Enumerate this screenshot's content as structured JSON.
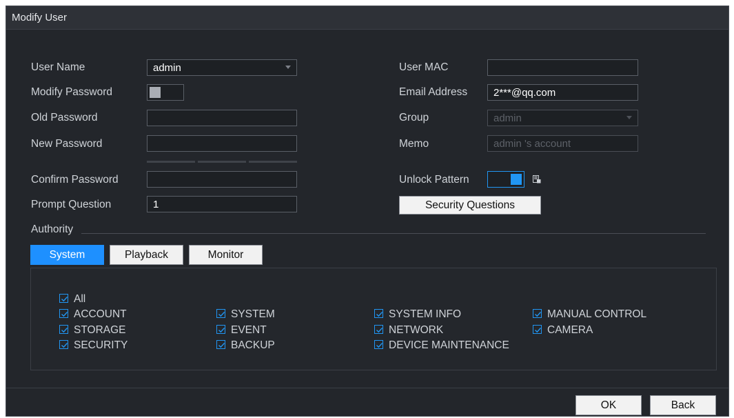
{
  "window": {
    "title": "Modify User"
  },
  "form": {
    "user_name": {
      "label": "User Name",
      "value": "admin"
    },
    "modify_password": {
      "label": "Modify Password",
      "enabled": false
    },
    "old_password": {
      "label": "Old Password",
      "value": ""
    },
    "new_password": {
      "label": "New Password",
      "value": ""
    },
    "confirm_password": {
      "label": "Confirm Password",
      "value": ""
    },
    "prompt_question": {
      "label": "Prompt Question",
      "value": "1"
    },
    "user_mac": {
      "label": "User MAC",
      "value": ""
    },
    "email": {
      "label": "Email Address",
      "value": "2***@qq.com"
    },
    "group": {
      "label": "Group",
      "value": "admin"
    },
    "memo": {
      "label": "Memo",
      "value": "admin 's account"
    },
    "unlock_pattern": {
      "label": "Unlock Pattern",
      "enabled": true
    },
    "security_questions_button": "Security Questions"
  },
  "authority": {
    "label": "Authority",
    "tabs": [
      "System",
      "Playback",
      "Monitor"
    ],
    "active_tab": "System",
    "permissions": {
      "all": "All",
      "col1": [
        "ACCOUNT",
        "STORAGE",
        "SECURITY"
      ],
      "col2": [
        "SYSTEM",
        "EVENT",
        "BACKUP"
      ],
      "col3": [
        "SYSTEM INFO",
        "NETWORK",
        "DEVICE MAINTENANCE"
      ],
      "col4": [
        "MANUAL CONTROL",
        "CAMERA"
      ]
    }
  },
  "footer": {
    "ok": "OK",
    "back": "Back"
  },
  "colors": {
    "accent": "#1e90ff",
    "background": "#23262b"
  }
}
